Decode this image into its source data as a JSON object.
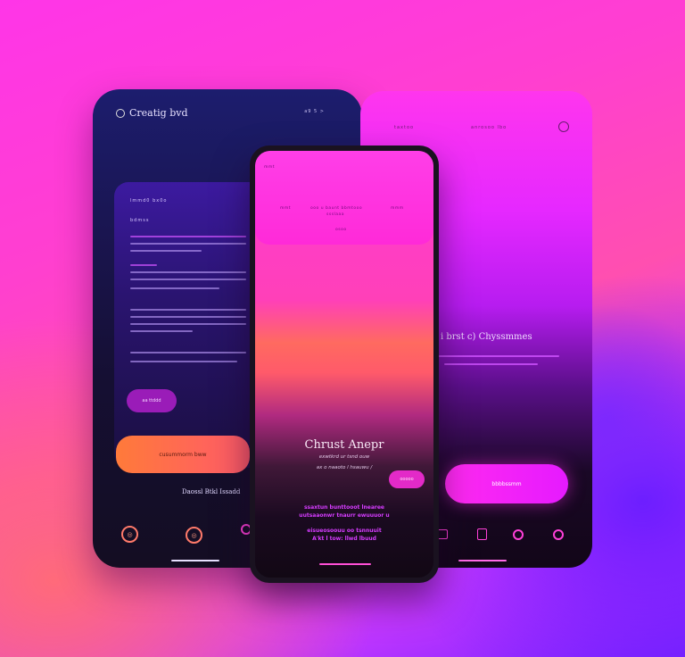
{
  "left_phone": {
    "app_title": "Creatig bvd",
    "status": "a9 5 >",
    "card_heading": "lmmd0 bx0o",
    "card_subheading": "bdmss",
    "chip_label": "aa ttddd",
    "cta_label": "cusummorm bww",
    "footer_text": "Daossl Btkl Issadd",
    "nav_icons": [
      "circle-icon",
      "circle-icon",
      "circle-icon"
    ]
  },
  "right_phone": {
    "top_left": "taxtoo",
    "top_center": "anrosoo lbo",
    "heading": "i brst c) Chyssmmes",
    "cta_label": "bbbbssmm"
  },
  "center_phone": {
    "header_left": "mmt",
    "header_center": "ooo u baunt bbmtooo",
    "header_center_2": "ssslaaa",
    "header_right": "mmm",
    "header_bottom": "osoo",
    "title": "Chrust Anepr",
    "subtitle_1": "exwtkrd ur tsnd ouw",
    "subtitle_2": "ax o naaoto l hsauwu /",
    "button_label": "ooooo",
    "feature_1": "ssaxtun bunttooot lnearee",
    "feature_2": "uutsaaonwr tnaurr ewuuuor u",
    "feature_3": "eisueosoouu oo tsnnuuit",
    "feature_4": "A'kt l tow: llwd lbuud"
  },
  "colors": {
    "background_primary": "#ff35e8",
    "accent_purple": "#6a1cff",
    "accent_orange": "#ff7a3a"
  }
}
